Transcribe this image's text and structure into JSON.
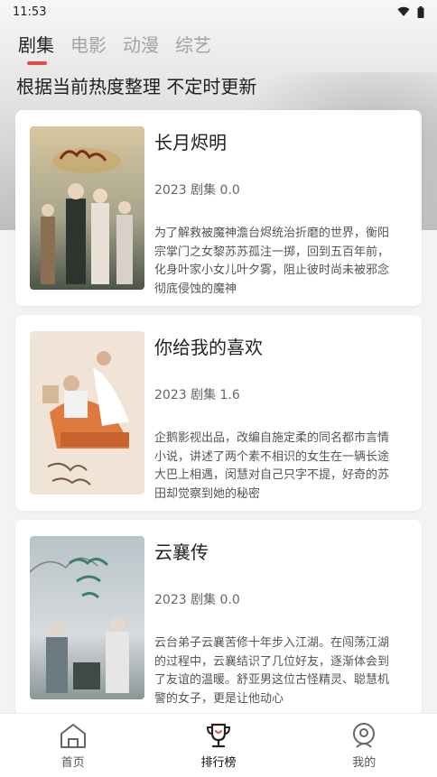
{
  "status_bar": {
    "time": "11:53"
  },
  "tabs": [
    {
      "label": "剧集",
      "active": true
    },
    {
      "label": "电影",
      "active": false
    },
    {
      "label": "动漫",
      "active": false
    },
    {
      "label": "综艺",
      "active": false
    }
  ],
  "subtitle": "根据当前热度整理 不定时更新",
  "items": [
    {
      "title": "长月烬明",
      "meta": "2023 剧集 0.0",
      "desc": "为了解救被魔神澹台烬统治折磨的世界，衡阳宗掌门之女黎苏苏孤注一掷，回到五百年前，化身叶家小女儿叶夕雾，阻止彼时尚未被邪念彻底侵蚀的魔神"
    },
    {
      "title": "你给我的喜欢",
      "meta": "2023 剧集 1.6",
      "desc": "企鹅影视出品，改编自施定柔的同名都市言情小说，讲述了两个素不相识的女生在一辆长途大巴上相遇，闵慧对自己只字不提，好奇的苏田却觉察到她的秘密"
    },
    {
      "title": "云襄传",
      "meta": "2023 剧集 0.0",
      "desc": "云台弟子云襄苦修十年步入江湖。在闯荡江湖的过程中，云襄结识了几位好友，逐渐体会到了友谊的温暖。舒亚男这位古怪精灵、聪慧机警的女子，更是让他动心"
    }
  ],
  "nav": [
    {
      "label": "首页",
      "icon": "home-icon",
      "active": false
    },
    {
      "label": "排行榜",
      "icon": "trophy-icon",
      "active": true
    },
    {
      "label": "我的",
      "icon": "profile-icon",
      "active": false
    }
  ],
  "colors": {
    "accent": "#e24a48"
  }
}
